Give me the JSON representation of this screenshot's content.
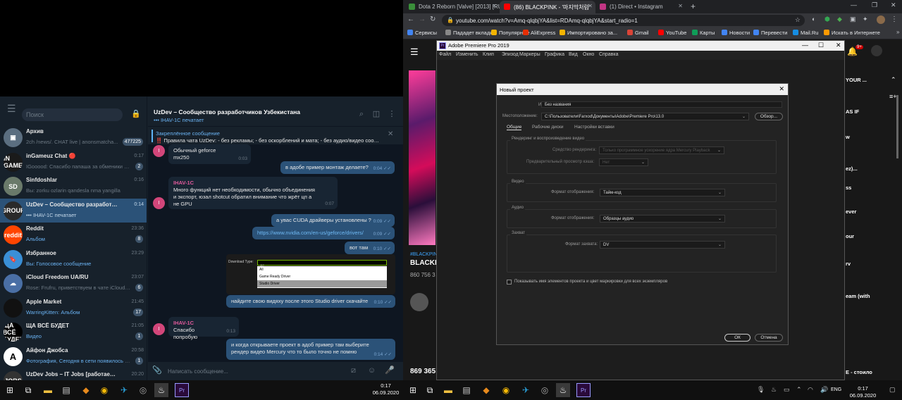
{
  "telegram": {
    "search_placeholder": "Поиск",
    "chats": [
      {
        "title": "Архив",
        "msg_hl": "",
        "msg": "2ch /news/. CHAT live | anonsmatcha...",
        "time": "",
        "badge": "477225",
        "avatar_color": "#5b6e80",
        "avatar_text": "▣"
      },
      {
        "title": "inGameuz Chat 🔴",
        "msg_hl": "",
        "msg": "IGooood: Спасибо папаша за обменики бе...",
        "time": "0:17",
        "badge": "2",
        "avatar_color": "#1a1a1a",
        "avatar_text": "IN GAME"
      },
      {
        "title": "Sinfdoshlar",
        "msg_hl": "",
        "msg": "Вы: zorku ozlarin qandesla nma yangilla",
        "time": "0:16",
        "badge": "",
        "avatar_color": "#6a7a6a",
        "avatar_text": "SD"
      },
      {
        "title": "UzDev – Сообщество разработч...",
        "msg_hl": "••• IHAV-1C печатает",
        "msg": "",
        "time": "0:14",
        "badge": "",
        "avatar_color": "#2a2a2a",
        "avatar_text": "GROUP"
      },
      {
        "title": "Reddit",
        "msg_hl": "Альбом",
        "msg": "",
        "time": "23:36",
        "badge": "8",
        "avatar_color": "#ff4500",
        "avatar_text": "reddit"
      },
      {
        "title": "Избранное",
        "msg_hl": "Вы: Голосовое сообщение",
        "msg": "",
        "time": "23:29",
        "badge": "",
        "avatar_color": "#3a8fd6",
        "avatar_text": "🔖"
      },
      {
        "title": "iCloud Freedom UA/RU",
        "msg_hl": "",
        "msg": "Rose: Frufru, приветствуем в чате iCloud Fr...",
        "time": "23:07",
        "badge": "6",
        "avatar_color": "#4a6fa5",
        "avatar_text": "☁"
      },
      {
        "title": "Apple Market",
        "msg_hl": "WarringKitten: Альбом",
        "msg": "",
        "time": "21:45",
        "badge": "17",
        "avatar_color": "#111",
        "avatar_text": ""
      },
      {
        "title": "ЩА ВСЁ БУДЕТ",
        "msg_hl": "Видео",
        "msg": "",
        "time": "21:05",
        "badge": "1",
        "avatar_color": "#000",
        "avatar_text": "ЩА ВСЁ БУДЕТ"
      },
      {
        "title": "Айфон Джобса",
        "msg_hl": "Фотография, Сегодня в сети появилось оф...",
        "msg": "",
        "time": "20:58",
        "badge": "1",
        "avatar_color": "#fff",
        "avatar_text": "A"
      },
      {
        "title": "UzDev Jobs – IT Jobs [работаем из д...",
        "msg_hl": "",
        "msg": "",
        "time": "20:20",
        "badge": "",
        "avatar_color": "#333",
        "avatar_text": "JOBS"
      }
    ],
    "header": {
      "title": "UzDev – Сообщество разработчиков Узбекистана",
      "typing": "••• IHAV-1C печатает"
    },
    "pinned": {
      "title": "Закреплённое сообщение",
      "text": "‼️ Правила чата UzDev: - без рекламы; - без оскорблений и мата; - без аудио/видео сооб..."
    },
    "messages": [
      {
        "text": "Обычный geforce mx250",
        "time": "0:03"
      },
      {
        "text": "в адобе пример монтаж делаете?",
        "time": "0:04"
      },
      {
        "sender": "IHAV-1C",
        "text": "Много функций нет необходимости, обычно объединения и экспорт, юзал   shotcut обратил внимание что жрёт цп а не GPU",
        "time": "0:07"
      },
      {
        "text": "а увас CUDA драйверы установлены ?",
        "time": "0:09"
      },
      {
        "text": "https://www.nvidia.com/en-us/geforce/drivers/",
        "time": "0:09"
      },
      {
        "text": "вот там",
        "time": "0:10"
      },
      {
        "text": "найдите свою видяху после этого Studio driver  скачайте",
        "time": "0:10"
      },
      {
        "sender": "IHAV-1C",
        "text": "Спасибо попробую",
        "time": "0:13"
      },
      {
        "text": "и когда открываете проект в адоб пример там выберите рендер видео  Mercury что то было точно не помню",
        "time": "0:14"
      }
    ],
    "avatar_letter": "I",
    "download_shot": {
      "label": "Download Type:",
      "selected": "All",
      "options": [
        "All",
        "Game Ready Driver",
        "Studio Driver"
      ]
    },
    "input_placeholder": "Написать сообщение..."
  },
  "taskbar_left": {
    "time": "0:17",
    "date": "06.09.2020"
  },
  "chrome": {
    "tabs": [
      {
        "title": "Dota 2 Reborn [Valve] [2013] [RU",
        "color": "#3a8f3a"
      },
      {
        "title": "(86) BLACKPINK - '마지막처럼'",
        "color": "#ff0000"
      },
      {
        "title": "(1) Direct • Instagram",
        "color": "#c13584"
      }
    ],
    "url": "youtube.com/watch?v=Amq-qlqbjYA&list=RDAmq-qlqbjYA&start_radio=1",
    "bookmarks": [
      {
        "label": "Сервисы",
        "color": "#4285f4"
      },
      {
        "label": "Пададет вкладка",
        "color": "#888"
      },
      {
        "label": "Популярные",
        "color": "#f4b400"
      },
      {
        "label": "AliExpress",
        "color": "#e62e04"
      },
      {
        "label": "Импортировано за...",
        "color": "#f4b400"
      },
      {
        "label": "Gmail",
        "color": "#db4437"
      },
      {
        "label": "YouTube",
        "color": "#ff0000"
      },
      {
        "label": "Карты",
        "color": "#0f9d58"
      },
      {
        "label": "Новости",
        "color": "#4285f4"
      },
      {
        "label": "Перевести",
        "color": "#4285f4"
      },
      {
        "label": "Mail.Ru",
        "color": "#168de2"
      },
      {
        "label": "Искать в Интернете",
        "color": "#ff9900"
      }
    ],
    "notif_badge": "9+"
  },
  "youtube": {
    "tag": "#BLACKPIN",
    "title_frag": "BLACKP",
    "views_frag": "860 756 3",
    "likes_frag": "869 365",
    "right_items": [
      "YOUR ...",
      "AS IF",
      "w",
      "ez)...",
      "ss",
      "ever",
      "our",
      "rv",
      "eam (with",
      "E - стоило"
    ]
  },
  "premiere": {
    "title": "Adobe Premiere Pro 2019",
    "menu": [
      "Файл",
      "Изменить",
      "Клип",
      "Эпизод",
      "Маркеры",
      "Графика",
      "Вид",
      "Окно",
      "Справка"
    ],
    "dialog": {
      "title": "Новый проект",
      "name_label": "Имя:",
      "name_value": "Без названия",
      "loc_label": "Местоположение:",
      "loc_value": "C:\\Пользователи\\Farxod\\Документы\\Adobe\\Premiere Pro\\13.0",
      "browse": "Обзор...",
      "tabs": [
        "Общие",
        "Рабочие диски",
        "Настройки вставки"
      ],
      "render_group": "Рендеринг и воспроизведение видео",
      "renderer_label": "Средство рендеринга:",
      "renderer_value": "Только программное ускорение ядра Mercury Playback",
      "preview_label": "Предварительный просмотр кэша:",
      "preview_value": "Нет",
      "video_group": "Видео",
      "video_label": "Формат отображения:",
      "video_value": "Тайм-код",
      "audio_group": "Аудио",
      "audio_label": "Формат отображения:",
      "audio_value": "Образцы аудио",
      "capture_group": "Захват",
      "capture_label": "Формат захвата:",
      "capture_value": "DV",
      "checkbox_label": "Показывать имя элементов проекта и цвет маркировки для всех экземпляров",
      "ok": "ОК",
      "cancel": "Отмена"
    }
  },
  "taskbar_right": {
    "time": "0:17",
    "date": "06.09.2020",
    "lang": "ENG"
  }
}
